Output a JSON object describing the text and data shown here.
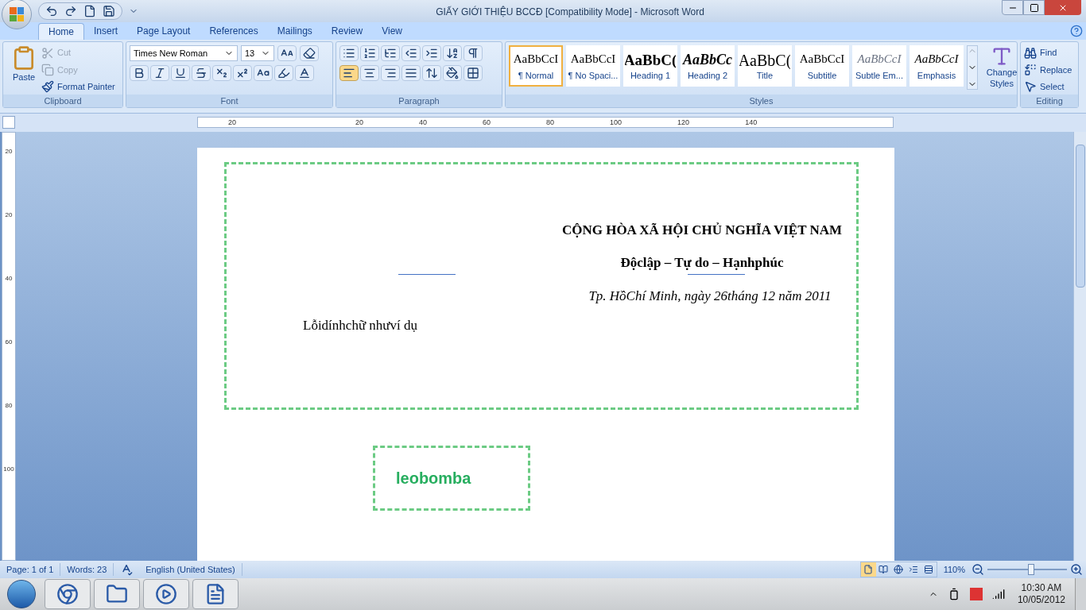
{
  "window": {
    "title": "GIẤY GIỚI THIỆU BCCĐ [Compatibility Mode] - Microsoft Word"
  },
  "tabs": [
    {
      "label": "Home",
      "selected": true
    },
    {
      "label": "Insert",
      "selected": false
    },
    {
      "label": "Page Layout",
      "selected": false
    },
    {
      "label": "References",
      "selected": false
    },
    {
      "label": "Mailings",
      "selected": false
    },
    {
      "label": "Review",
      "selected": false
    },
    {
      "label": "View",
      "selected": false
    }
  ],
  "clipboard": {
    "label": "Clipboard",
    "paste": "Paste",
    "cut": {
      "label": "Cut",
      "disabled": true
    },
    "copy": {
      "label": "Copy",
      "disabled": true
    },
    "format_painter": {
      "label": "Format Painter",
      "disabled": false
    }
  },
  "font": {
    "label": "Font",
    "name": "Times New Roman",
    "size": "13"
  },
  "paragraph": {
    "label": "Paragraph",
    "alignments": [
      {
        "kind": "left",
        "selected": true
      },
      {
        "kind": "center",
        "selected": false
      },
      {
        "kind": "right",
        "selected": false
      },
      {
        "kind": "justify",
        "selected": false
      }
    ]
  },
  "styles": {
    "label": "Styles",
    "items": [
      {
        "preview": "AaBbCcI",
        "name": "¶ Normal",
        "kind": "normal",
        "selected": true
      },
      {
        "preview": "AaBbCcI",
        "name": "¶ No Spaci...",
        "kind": "normal",
        "selected": false
      },
      {
        "preview": "AaBbC(",
        "name": "Heading 1",
        "kind": "heading",
        "selected": false
      },
      {
        "preview": "AaBbCc",
        "name": "Heading 2",
        "kind": "heading-italic",
        "selected": false
      },
      {
        "preview": "AaBbC(",
        "name": "Title",
        "kind": "title",
        "selected": false
      },
      {
        "preview": "AaBbCcI",
        "name": "Subtitle",
        "kind": "normal",
        "selected": false
      },
      {
        "preview": "AaBbCcI",
        "name": "Subtle Em...",
        "kind": "subtle",
        "selected": false
      },
      {
        "preview": "AaBbCcI",
        "name": "Emphasis",
        "kind": "italic",
        "selected": false
      }
    ],
    "change_styles": "Change Styles"
  },
  "editing": {
    "label": "Editing",
    "find": "Find",
    "replace": "Replace",
    "select": "Select"
  },
  "ruler": {
    "labels": [
      "20",
      "20",
      "40",
      "60",
      "80",
      "100",
      "120",
      "140"
    ],
    "vertical_labels": [
      "20",
      "20",
      "40",
      "60",
      "80",
      "100"
    ]
  },
  "document": {
    "nation": "CỘNG HÒA XÃ HỘI CHỦ NGHĨA VIỆT NAM",
    "motto": "Độclập – Tự do – Hạnhphúc",
    "date": "Tp. HồChí Minh, ngày 26tháng 12 năm 2011",
    "note": "Lỗidínhchữ nhưví dụ",
    "stamp": "leobomba"
  },
  "status_bar": {
    "page": "Page: 1 of 1",
    "words": "Words: 23",
    "language": "English (United States)",
    "views": [
      {
        "kind": "print",
        "selected": true
      },
      {
        "kind": "reading",
        "selected": false
      },
      {
        "kind": "web",
        "selected": false
      },
      {
        "kind": "outline",
        "selected": false
      },
      {
        "kind": "draft",
        "selected": false
      }
    ],
    "zoom": "110%",
    "zoom_slider": {
      "level": 0.55
    }
  },
  "taskbar": {
    "apps": [
      {
        "kind": "browser"
      },
      {
        "kind": "folder"
      },
      {
        "kind": "media"
      },
      {
        "kind": "word"
      }
    ],
    "time": "10:30 AM",
    "date": "10/05/2012"
  }
}
